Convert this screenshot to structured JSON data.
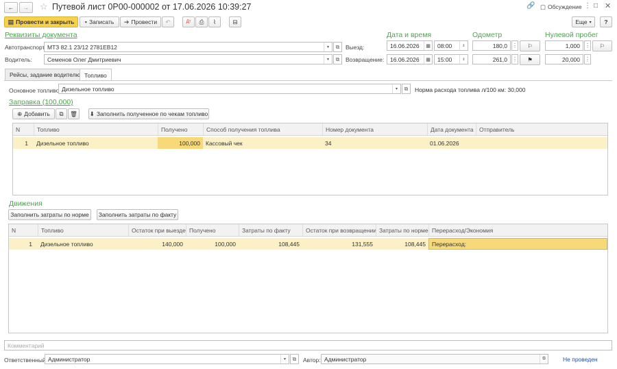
{
  "window": {
    "title": "Путевой лист 0Р00-000002 от 17.06.2026 10:39:27",
    "discussion": "Обсуждение",
    "more": "Еще",
    "help": "?"
  },
  "toolbar": {
    "post_close": "Провести и закрыть",
    "save": "Записать",
    "post": "Провести"
  },
  "sections": {
    "requisites": "Реквизиты документа",
    "datetime": "Дата и время",
    "odometer": "Одометр",
    "zero_run": "Нулевой пробег",
    "refuel": "Заправка (100,000)",
    "movements": "Движения"
  },
  "fields": {
    "vehicle_label": "Автотранспорт:",
    "vehicle": "МТЗ 82.1 23/12 2781ЕВ12",
    "driver_label": "Водитель:",
    "driver": "Семенов Олег Дмитриевич",
    "departure_label": "Выезд:",
    "departure_date": "16.06.2026",
    "departure_time": "08:00",
    "return_label": "Возвращение:",
    "return_date": "16.06.2026",
    "return_time": "15:00",
    "odo_out": "180,0",
    "odo_in": "261,0",
    "zero_out": "1,000",
    "zero_in": "20,000",
    "fuel_label": "Основное топливо:",
    "fuel": "Дизельное топливо",
    "fuel_norm": "Норма расхода топлива л/100 км: 30,000",
    "comment_placeholder": "Комментарий",
    "responsible_label": "Ответственный:",
    "responsible": "Администратор",
    "author_label": "Автор:",
    "author": "Администратор",
    "status": "Не проведен"
  },
  "tabs": [
    {
      "label": "Рейсы, задание водителю"
    },
    {
      "label": "Топливо"
    }
  ],
  "refuel_toolbar": {
    "add": "Добавить",
    "fill_checks": "Заполнить полученное по чекам топливо"
  },
  "refuel_table": {
    "columns": [
      "N",
      "Топливо",
      "Получено",
      "Способ получения топлива",
      "Номер документа",
      "Дата документа",
      "Отправитель"
    ],
    "rows": [
      [
        "1",
        "Дизельное топливо",
        "100,000",
        "Кассовый чек",
        "34",
        "01.06.2026",
        ""
      ]
    ]
  },
  "movement_toolbar": {
    "fill_norm": "Заполнить затраты по норме",
    "fill_fact": "Заполнить затраты по факту"
  },
  "movement_table": {
    "columns": [
      "N",
      "Топливо",
      "Остаток при выезде",
      "Получено",
      "Затраты по факту",
      "Остаток при возвращении",
      "Затраты по норме",
      "Перерасход/Экономия"
    ],
    "rows": [
      [
        "1",
        "Дизельное топливо",
        "140,000",
        "100,000",
        "108,445",
        "131,555",
        "108,445",
        "Перерасход:"
      ]
    ]
  }
}
